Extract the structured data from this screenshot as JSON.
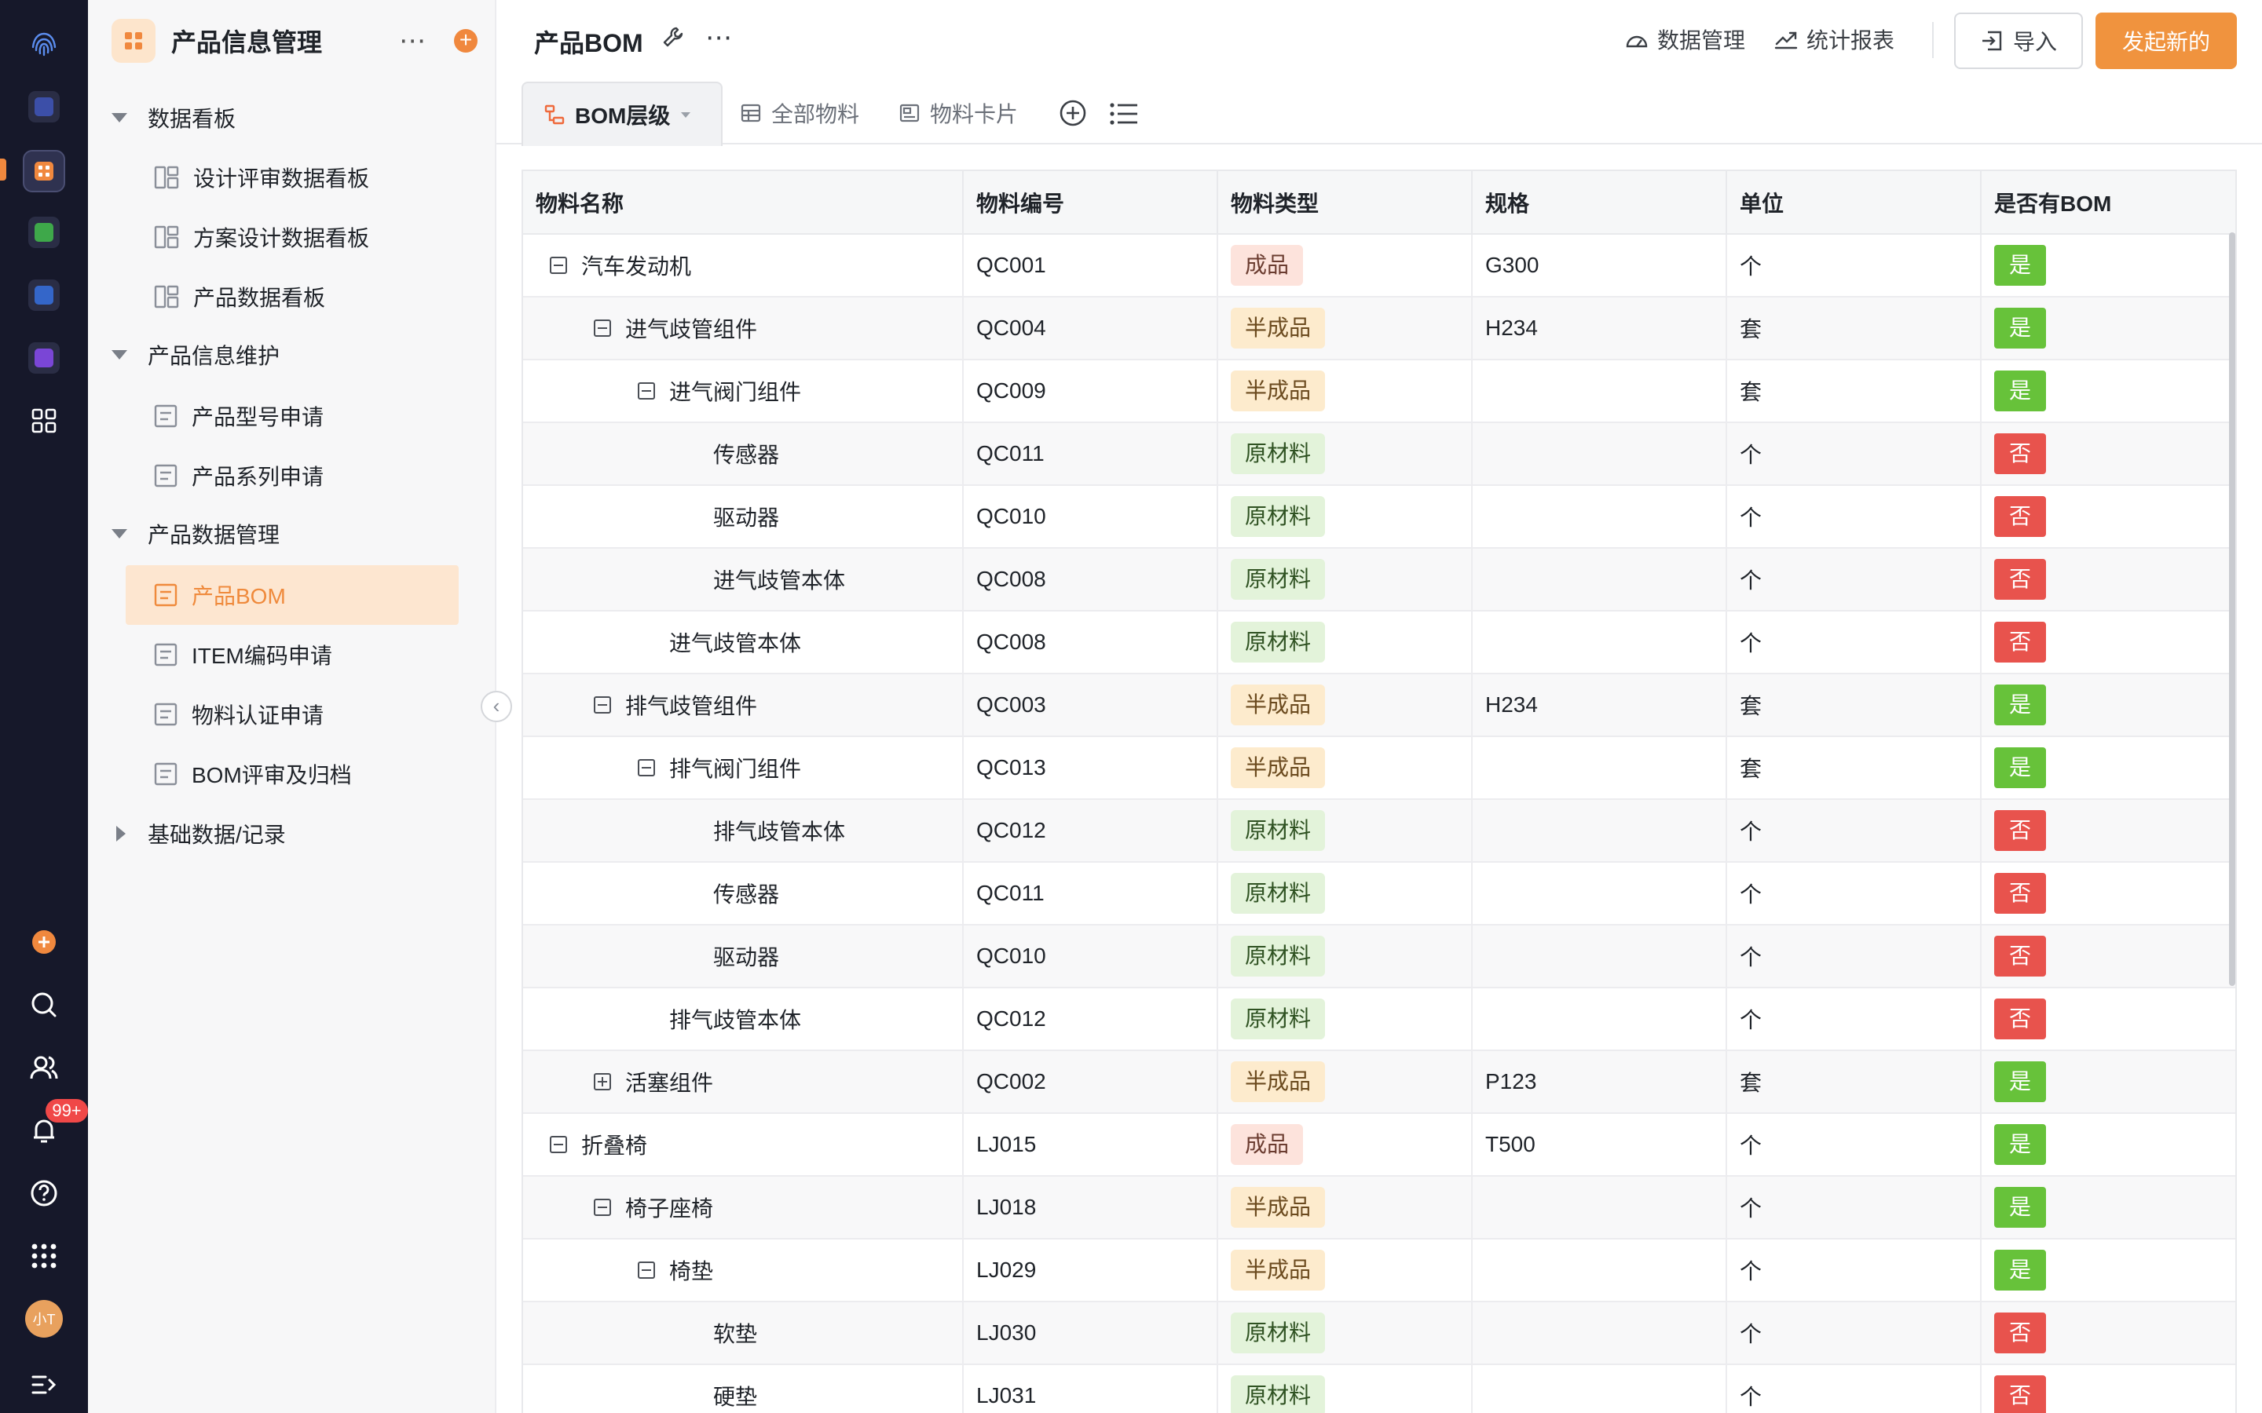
{
  "rail": {
    "notification_badge": "99+",
    "avatar_text": "小T"
  },
  "sidebar": {
    "title": "产品信息管理",
    "groups": [
      {
        "label": "数据看板",
        "items": [
          "设计评审数据看板",
          "方案设计数据看板",
          "产品数据看板"
        ]
      },
      {
        "label": "产品信息维护",
        "items": [
          "产品型号申请",
          "产品系列申请"
        ]
      },
      {
        "label": "产品数据管理",
        "items": [
          "产品BOM",
          "ITEM编码申请",
          "物料认证申请",
          "BOM评审及归档"
        ]
      },
      {
        "label": "基础数据/记录",
        "items": []
      }
    ],
    "active_item": "产品BOM"
  },
  "header": {
    "title": "产品BOM",
    "data_mgmt": "数据管理",
    "stats_report": "统计报表",
    "import": "导入",
    "create": "发起新的"
  },
  "tabs": [
    {
      "label": "BOM层级",
      "active": true
    },
    {
      "label": "全部物料",
      "active": false
    },
    {
      "label": "物料卡片",
      "active": false
    }
  ],
  "table": {
    "columns": [
      "物料名称",
      "物料编号",
      "物料类型",
      "规格",
      "单位",
      "是否有BOM"
    ],
    "rows": [
      {
        "level": 0,
        "toggle": "minus",
        "name": "汽车发动机",
        "code": "QC001",
        "type": "成品",
        "spec": "G300",
        "unit": "个",
        "bom": "是"
      },
      {
        "level": 1,
        "toggle": "minus",
        "name": "进气歧管组件",
        "code": "QC004",
        "type": "半成品",
        "spec": "H234",
        "unit": "套",
        "bom": "是"
      },
      {
        "level": 2,
        "toggle": "minus",
        "name": "进气阀门组件",
        "code": "QC009",
        "type": "半成品",
        "spec": "",
        "unit": "套",
        "bom": "是"
      },
      {
        "level": 3,
        "toggle": "",
        "name": "传感器",
        "code": "QC011",
        "type": "原材料",
        "spec": "",
        "unit": "个",
        "bom": "否"
      },
      {
        "level": 3,
        "toggle": "",
        "name": "驱动器",
        "code": "QC010",
        "type": "原材料",
        "spec": "",
        "unit": "个",
        "bom": "否"
      },
      {
        "level": 3,
        "toggle": "",
        "name": "进气歧管本体",
        "code": "QC008",
        "type": "原材料",
        "spec": "",
        "unit": "个",
        "bom": "否"
      },
      {
        "level": 2,
        "toggle": "",
        "name": "进气歧管本体",
        "code": "QC008",
        "type": "原材料",
        "spec": "",
        "unit": "个",
        "bom": "否"
      },
      {
        "level": 1,
        "toggle": "minus",
        "name": "排气歧管组件",
        "code": "QC003",
        "type": "半成品",
        "spec": "H234",
        "unit": "套",
        "bom": "是"
      },
      {
        "level": 2,
        "toggle": "minus",
        "name": "排气阀门组件",
        "code": "QC013",
        "type": "半成品",
        "spec": "",
        "unit": "套",
        "bom": "是"
      },
      {
        "level": 3,
        "toggle": "",
        "name": "排气歧管本体",
        "code": "QC012",
        "type": "原材料",
        "spec": "",
        "unit": "个",
        "bom": "否"
      },
      {
        "level": 3,
        "toggle": "",
        "name": "传感器",
        "code": "QC011",
        "type": "原材料",
        "spec": "",
        "unit": "个",
        "bom": "否"
      },
      {
        "level": 3,
        "toggle": "",
        "name": "驱动器",
        "code": "QC010",
        "type": "原材料",
        "spec": "",
        "unit": "个",
        "bom": "否"
      },
      {
        "level": 2,
        "toggle": "",
        "name": "排气歧管本体",
        "code": "QC012",
        "type": "原材料",
        "spec": "",
        "unit": "个",
        "bom": "否"
      },
      {
        "level": 1,
        "toggle": "plus",
        "name": "活塞组件",
        "code": "QC002",
        "type": "半成品",
        "spec": "P123",
        "unit": "套",
        "bom": "是"
      },
      {
        "level": 0,
        "toggle": "minus",
        "name": "折叠椅",
        "code": "LJ015",
        "type": "成品",
        "spec": "T500",
        "unit": "个",
        "bom": "是"
      },
      {
        "level": 1,
        "toggle": "minus",
        "name": "椅子座椅",
        "code": "LJ018",
        "type": "半成品",
        "spec": "",
        "unit": "个",
        "bom": "是"
      },
      {
        "level": 2,
        "toggle": "minus",
        "name": "椅垫",
        "code": "LJ029",
        "type": "半成品",
        "spec": "",
        "unit": "个",
        "bom": "是"
      },
      {
        "level": 3,
        "toggle": "",
        "name": "软垫",
        "code": "LJ030",
        "type": "原材料",
        "spec": "",
        "unit": "个",
        "bom": "否"
      },
      {
        "level": 3,
        "toggle": "",
        "name": "硬垫",
        "code": "LJ031",
        "type": "原材料",
        "spec": "",
        "unit": "个",
        "bom": "否"
      }
    ]
  },
  "colors": {
    "accent": "#f0883e",
    "rail_bg": "#16182a",
    "yes_green": "#67c23a",
    "no_red": "#e8534d",
    "finished_tag_bg": "#fde3dc",
    "semi_tag_bg": "#fdebcd",
    "raw_tag_bg": "#e3f3da"
  }
}
